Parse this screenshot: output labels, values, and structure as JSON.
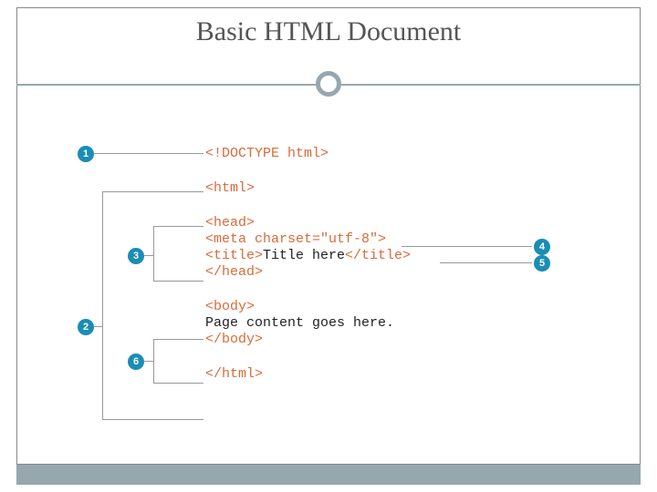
{
  "title": "Basic HTML Document",
  "code": {
    "doctype": "<!DOCTYPE html>",
    "html_open": "<html>",
    "head_open": "<head>",
    "meta": "<meta charset=\"utf-8\">",
    "title_open": "<title>",
    "title_text": "Title here",
    "title_close": "</title>",
    "head_close": "</head>",
    "body_open": "<body>",
    "body_text": "Page content goes here.",
    "body_close": "</body>",
    "html_close": "</html>"
  },
  "badges": {
    "b1": "1",
    "b2": "2",
    "b3": "3",
    "b4": "4",
    "b5": "5",
    "b6": "6"
  }
}
